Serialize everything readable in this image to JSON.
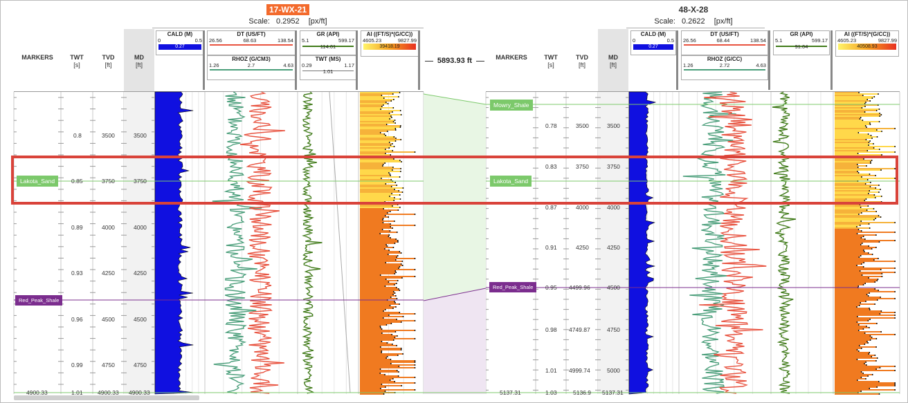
{
  "wells": [
    {
      "name": "17-WX-21",
      "scale_label": "Scale:",
      "scale_value": "0.2952",
      "scale_unit": "[px/ft]",
      "columns": {
        "markers": "MARKERS",
        "twt": "TWT",
        "twt_unit": "[s]",
        "tvd": "TVD",
        "tvd_unit": "[ft]",
        "md": "MD",
        "md_unit": "[ft]"
      },
      "curves": {
        "cald": {
          "name": "CALD (M)",
          "min": "0",
          "max": "0.5",
          "value": "0.27"
        },
        "dt": {
          "name": "DT (US/FT)",
          "min": "26.56",
          "value": "68.63",
          "max": "138.54"
        },
        "rhoz": {
          "name": "RHOZ (G/CM3)",
          "min": "1.26",
          "value": "2.7",
          "max": "4.63"
        },
        "gr": {
          "name": "GR (API)",
          "min": "5.1",
          "max": "599.17",
          "value": "114.01"
        },
        "twt": {
          "name": "TWT (MS)",
          "min": "0.29",
          "max": "1.17",
          "value": "1.01"
        },
        "ai": {
          "name": "AI ((FT/S)*(G/CC))",
          "min": "4605.23",
          "max": "9827.99",
          "value": "39418.19"
        }
      },
      "markers": [
        {
          "name": "Lakota_Sand"
        },
        {
          "name": "Red_Peak_Shale"
        }
      ],
      "twt_labels": [
        "0.8",
        "0.85",
        "0.89",
        "0.93",
        "0.96",
        "0.99",
        "1.01"
      ],
      "tvd_labels": [
        "3500",
        "3750",
        "4000",
        "4250",
        "4500",
        "4750",
        "4900.33"
      ],
      "md_labels": [
        "3500",
        "3750",
        "4000",
        "4250",
        "4500",
        "4750",
        "4900.33"
      ],
      "bottom_marker_depth": "4900.33"
    },
    {
      "name": "48-X-28",
      "scale_label": "Scale:",
      "scale_value": "0.2622",
      "scale_unit": "[px/ft]",
      "columns": {
        "markers": "MARKERS",
        "twt": "TWT",
        "twt_unit": "[s]",
        "tvd": "TVD",
        "tvd_unit": "[ft]",
        "md": "MD",
        "md_unit": "[ft]"
      },
      "curves": {
        "cald": {
          "name": "CALD (M)",
          "min": "0",
          "max": "0.5",
          "value": "0.27"
        },
        "dt": {
          "name": "DT (US/FT)",
          "min": "26.56",
          "value": "68.44",
          "max": "138.54"
        },
        "rhoz": {
          "name": "RHOZ (G/CC)",
          "min": "1.26",
          "value": "2.72",
          "max": "4.63"
        },
        "gr": {
          "name": "GR (API)",
          "min": "5.1",
          "max": "599.17",
          "value": "91.04"
        },
        "ai": {
          "name": "AI ((FT/S)*(G/CC))",
          "min": "4605.23",
          "max": "9827.99",
          "value": "40508.93"
        }
      },
      "markers": [
        {
          "name": "Mowry_Shale"
        },
        {
          "name": "Lakota_Sand"
        },
        {
          "name": "Red_Peak_Shale"
        }
      ],
      "twt_labels": [
        "0.78",
        "0.83",
        "0.87",
        "0.91",
        "0.95",
        "0.98",
        "1.01",
        "1.03"
      ],
      "tvd_labels": [
        "3500",
        "3750",
        "4000",
        "4250",
        "4499.96",
        "4749.87",
        "4999.74",
        "5136.9"
      ],
      "md_labels": [
        "3500",
        "3750",
        "4000",
        "4250",
        "4500",
        "4750",
        "5000",
        "5137.31"
      ],
      "bottom_marker_depth": "5137.31"
    }
  ],
  "distance": "5893.93 ft",
  "colors": {
    "highlight": "#d9433a",
    "marker_green": "#7cc96b",
    "marker_purple": "#7b2d8e",
    "cald": "#1010e0",
    "dt": "#e8523f",
    "rhoz": "#4a9e7a",
    "gr": "#3f7a18",
    "ai_light": "#ffd84a",
    "ai_dark": "#f07a20"
  }
}
